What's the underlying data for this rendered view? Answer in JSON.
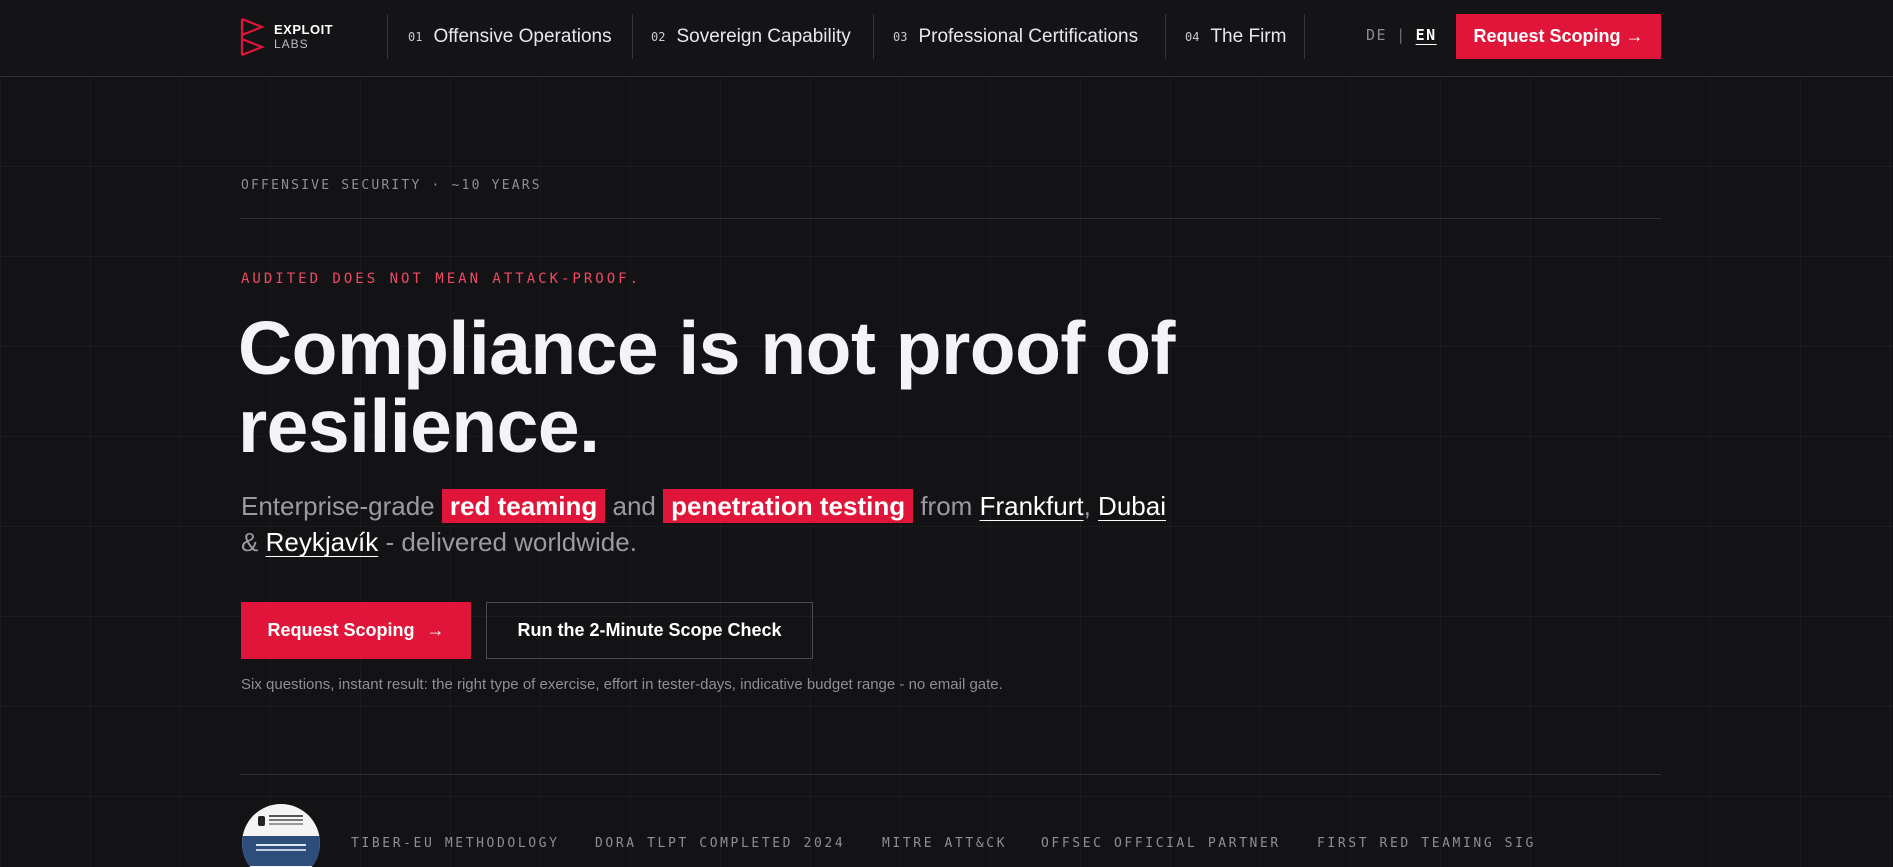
{
  "header": {
    "logo": {
      "line1": "EXPLOIT",
      "line2": "LABS"
    },
    "nav": [
      {
        "num": "01",
        "label": "Offensive Operations"
      },
      {
        "num": "02",
        "label": "Sovereign Capability"
      },
      {
        "num": "03",
        "label": "Professional Certifications"
      },
      {
        "num": "04",
        "label": "The Firm"
      }
    ],
    "lang": {
      "de": "DE",
      "separator": "|",
      "en": "EN",
      "active": "EN"
    },
    "cta_label": "Request Scoping →"
  },
  "hero": {
    "eyebrow": "OFFENSIVE SECURITY · ~10 YEARS",
    "kicker": "AUDITED DOES NOT MEAN ATTACK-PROOF.",
    "headline": "Compliance is not proof of resilience.",
    "sub": {
      "t1": "Enterprise-grade ",
      "hl1": "red teaming",
      "t2": " and ",
      "hl2": "penetration testing",
      "t3": " from ",
      "city1": "Frankfurt",
      "t4": ", ",
      "city2": "Dubai",
      "t5": " & ",
      "city3": "Reykjavík",
      "t6": " - delivered worldwide."
    },
    "primary_button": {
      "label": "Request Scoping",
      "arrow": "→"
    },
    "secondary_button": {
      "label": "Run the 2-Minute Scope Check"
    },
    "note": "Six questions, instant result: the right type of exercise, effort in tester-days, indicative budget range - no email gate."
  },
  "badges": {
    "items": [
      "TIBER-EU METHODOLOGY",
      "DORA TLPT COMPLETED 2024",
      "MITRE ATT&CK",
      "OFFSEC OFFICIAL PARTNER",
      "FIRST RED TEAMING SIG"
    ]
  },
  "colors": {
    "accent": "#e11539",
    "background": "#131316",
    "kicker": "#ef4a63",
    "muted": "#8e8e94"
  }
}
